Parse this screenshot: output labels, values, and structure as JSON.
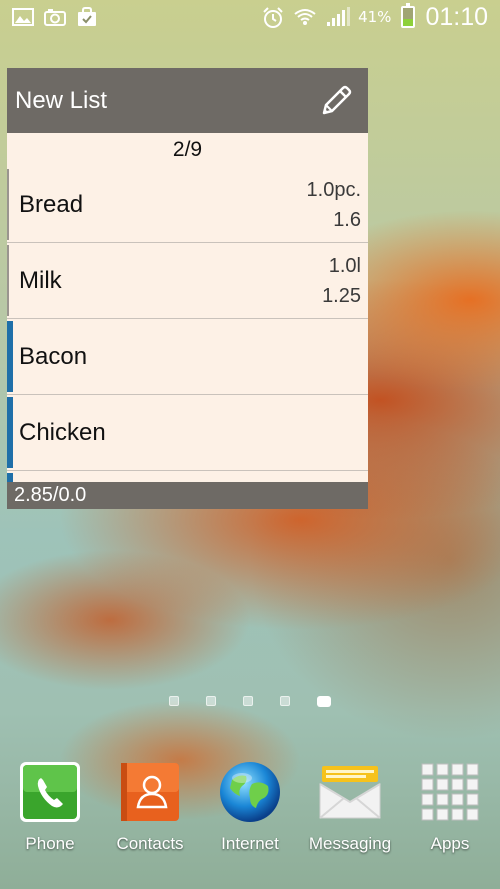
{
  "status_bar": {
    "left_icons": [
      "gallery-icon",
      "camera-icon",
      "shopping-bag-icon"
    ],
    "right_icons": [
      "alarm-icon",
      "wifi-icon",
      "signal-icon"
    ],
    "battery_percent": "41%",
    "battery_level": 0.41,
    "time": "01:10"
  },
  "widget": {
    "title": "New List",
    "edit_icon": "pencil-icon",
    "counter": "2/9",
    "items": [
      {
        "name": "Bread",
        "quantity": "1.0pc.",
        "price": "1.6",
        "state": "bought"
      },
      {
        "name": "Milk",
        "quantity": "1.0l",
        "price": "1.25",
        "state": "bought"
      },
      {
        "name": "Bacon",
        "quantity": "",
        "price": "",
        "state": "todo"
      },
      {
        "name": "Chicken",
        "quantity": "",
        "price": "",
        "state": "todo"
      },
      {
        "name": "",
        "quantity": "",
        "price": "",
        "state": "todo"
      }
    ],
    "footer_total": "2.85/0.0"
  },
  "home_pager": {
    "pages": 5,
    "active_index": 4
  },
  "dock": [
    {
      "label": "Phone",
      "icon": "phone-icon"
    },
    {
      "label": "Contacts",
      "icon": "contacts-icon"
    },
    {
      "label": "Internet",
      "icon": "globe-icon"
    },
    {
      "label": "Messaging",
      "icon": "envelope-icon"
    },
    {
      "label": "Apps",
      "icon": "apps-grid-icon"
    }
  ],
  "colors": {
    "widget_header": "#6e6a65",
    "widget_background": "#fdf1e6",
    "todo_marker": "#1f6fa8",
    "battery_fill": "#8ed03a"
  }
}
